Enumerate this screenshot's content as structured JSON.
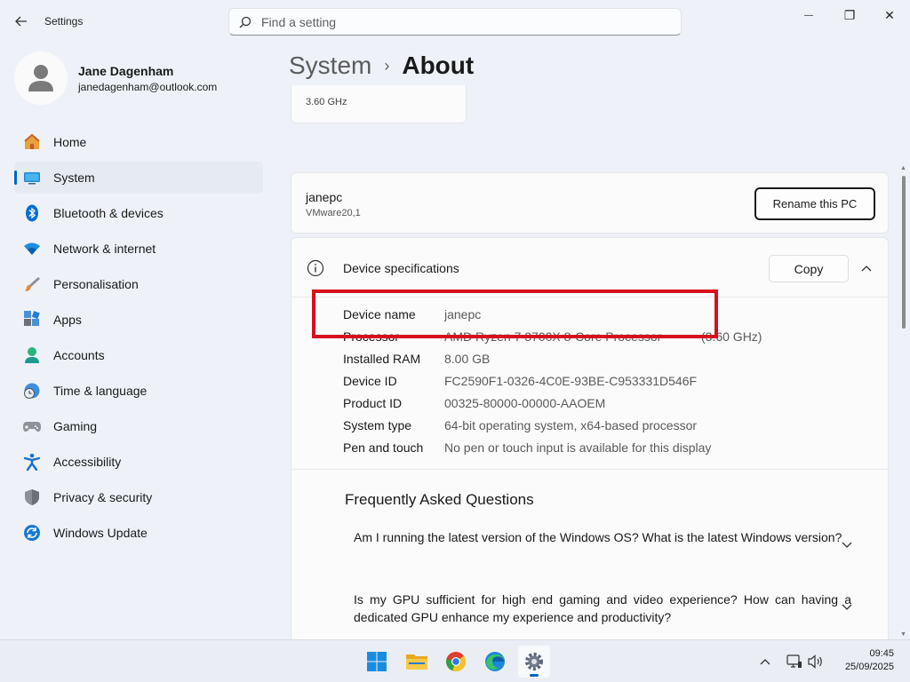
{
  "window": {
    "title": "Settings",
    "minimize_glyph": "—",
    "maximize_glyph": "❐",
    "close_glyph": "✕"
  },
  "search": {
    "placeholder": "Find a setting"
  },
  "profile": {
    "name": "Jane Dagenham",
    "email": "janedagenham@outlook.com"
  },
  "sidebar": {
    "items": [
      {
        "label": "Home",
        "icon": "home-icon"
      },
      {
        "label": "System",
        "icon": "system-icon",
        "active": true
      },
      {
        "label": "Bluetooth & devices",
        "icon": "bluetooth-icon"
      },
      {
        "label": "Network & internet",
        "icon": "wifi-icon"
      },
      {
        "label": "Personalisation",
        "icon": "brush-icon"
      },
      {
        "label": "Apps",
        "icon": "apps-icon"
      },
      {
        "label": "Accounts",
        "icon": "accounts-icon"
      },
      {
        "label": "Time & language",
        "icon": "clock-globe-icon"
      },
      {
        "label": "Gaming",
        "icon": "gamepad-icon"
      },
      {
        "label": "Accessibility",
        "icon": "accessibility-icon"
      },
      {
        "label": "Privacy & security",
        "icon": "shield-icon"
      },
      {
        "label": "Windows Update",
        "icon": "update-icon"
      }
    ]
  },
  "breadcrumb": {
    "parent": "System",
    "separator": "›",
    "current": "About"
  },
  "cpu_card": {
    "speed": "3.60 GHz"
  },
  "pc": {
    "name": "janepc",
    "model": "VMware20,1",
    "rename_label": "Rename this PC"
  },
  "specs": {
    "title": "Device specifications",
    "copy_label": "Copy",
    "rows": [
      {
        "key": "Device name",
        "value": "janepc",
        "extra": ""
      },
      {
        "key": "Processor",
        "value": "AMD Ryzen 7 3700X 8-Core Processor",
        "extra": "(3.60 GHz)"
      },
      {
        "key": "Installed RAM",
        "value": "8.00 GB",
        "extra": ""
      },
      {
        "key": "Device ID",
        "value": "FC2590F1-0326-4C0E-93BE-C953331D546F",
        "extra": ""
      },
      {
        "key": "Product ID",
        "value": "00325-80000-00000-AAOEM",
        "extra": ""
      },
      {
        "key": "System type",
        "value": "64-bit operating system, x64-based processor",
        "extra": ""
      },
      {
        "key": "Pen and touch",
        "value": "No pen or touch input is available for this display",
        "extra": ""
      }
    ]
  },
  "faq": {
    "title": "Frequently Asked Questions",
    "items": [
      {
        "question": "Am I running the latest version of the Windows OS? What is the latest Windows version?"
      },
      {
        "question": "Is my GPU sufficient for high end gaming and video experience? How can having a dedicated GPU enhance my experience and productivity?"
      }
    ]
  },
  "taskbar": {
    "apps": [
      "start-icon",
      "file-explorer-icon",
      "chrome-icon",
      "edge-icon",
      "settings-icon"
    ],
    "tray_chevron": "︿",
    "time": "09:45",
    "date": "25/09/2025"
  },
  "colors": {
    "accent": "#0067c0",
    "highlight": "#d6101c"
  }
}
